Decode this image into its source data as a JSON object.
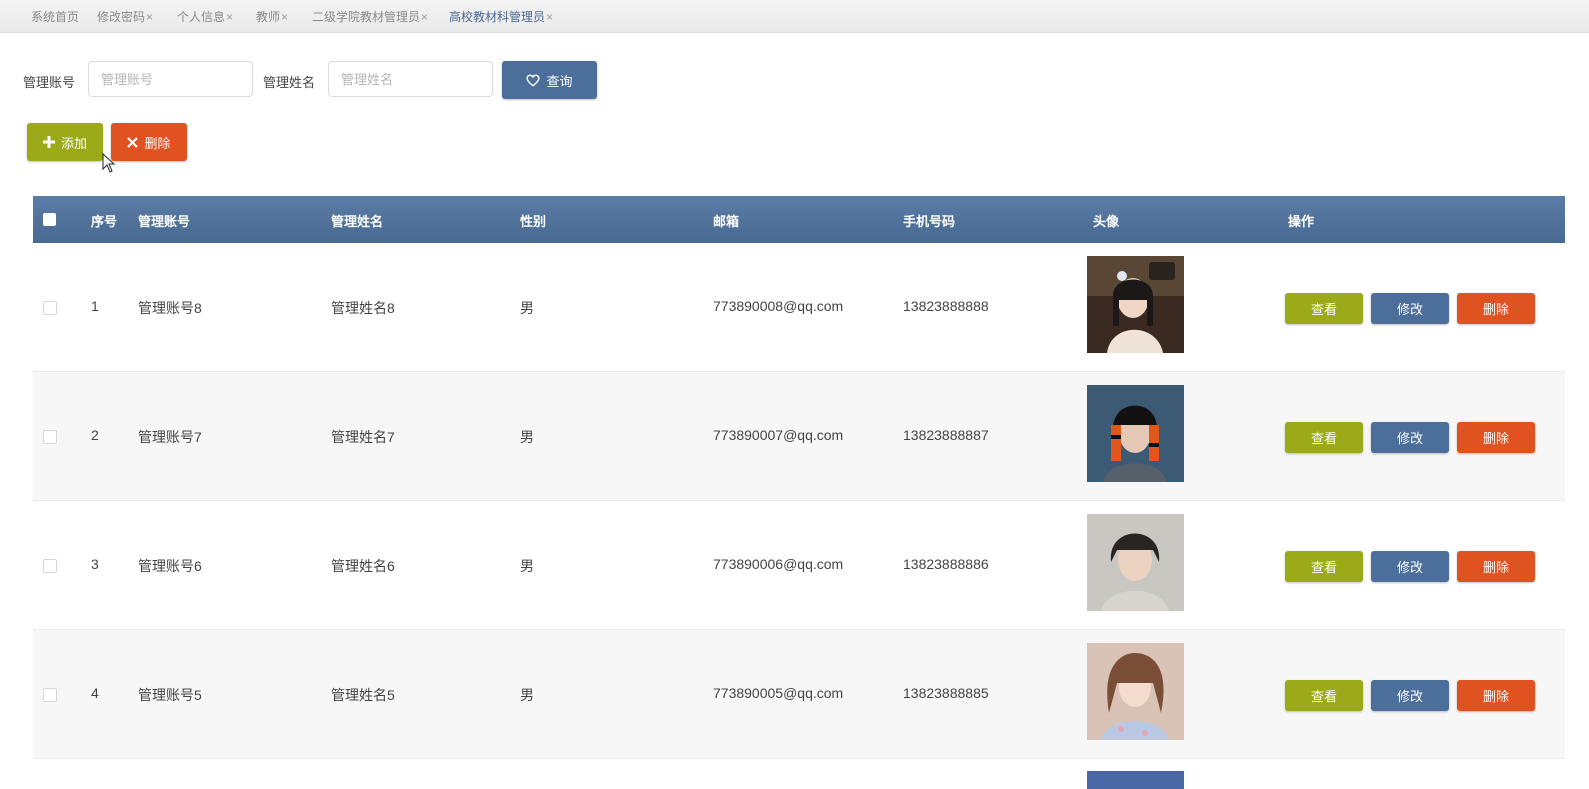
{
  "tabs": [
    {
      "label": "系统首页",
      "close": ""
    },
    {
      "label": "修改密码",
      "close": "×"
    },
    {
      "label": "个人信息",
      "close": "×"
    },
    {
      "label": "教师",
      "close": "×"
    },
    {
      "label": "二级学院教材管理员",
      "close": "×"
    },
    {
      "label": "高校教材科管理员",
      "close": "×"
    }
  ],
  "search": {
    "account_label": "管理账号",
    "account_placeholder": "管理账号",
    "name_label": "管理姓名",
    "name_placeholder": "管理姓名",
    "query_button": "查询",
    "query_icon": "heart-icon"
  },
  "toolbar": {
    "add_label": "添加",
    "add_icon": "plus-icon",
    "delete_label": "删除",
    "delete_icon": "close-icon"
  },
  "table": {
    "headers": {
      "index": "序号",
      "account": "管理账号",
      "name": "管理姓名",
      "gender": "性别",
      "email": "邮箱",
      "phone": "手机号码",
      "avatar": "头像",
      "actions": "操作"
    },
    "rows": [
      {
        "index": "1",
        "account": "管理账号8",
        "name": "管理姓名8",
        "gender": "男",
        "email": "773890008@qq.com",
        "phone": "13823888888",
        "view": "查看",
        "edit": "修改",
        "delete": "删除"
      },
      {
        "index": "2",
        "account": "管理账号7",
        "name": "管理姓名7",
        "gender": "男",
        "email": "773890007@qq.com",
        "phone": "13823888887",
        "view": "查看",
        "edit": "修改",
        "delete": "删除"
      },
      {
        "index": "3",
        "account": "管理账号6",
        "name": "管理姓名6",
        "gender": "男",
        "email": "773890006@qq.com",
        "phone": "13823888886",
        "view": "查看",
        "edit": "修改",
        "delete": "删除"
      },
      {
        "index": "4",
        "account": "管理账号5",
        "name": "管理姓名5",
        "gender": "男",
        "email": "773890005@qq.com",
        "phone": "13823888885",
        "view": "查看",
        "edit": "修改",
        "delete": "删除"
      }
    ]
  },
  "colors": {
    "primary": "#4c6e9b",
    "success": "#9aaa19",
    "danger": "#e05220",
    "header_bg": "#5a7ca6"
  }
}
